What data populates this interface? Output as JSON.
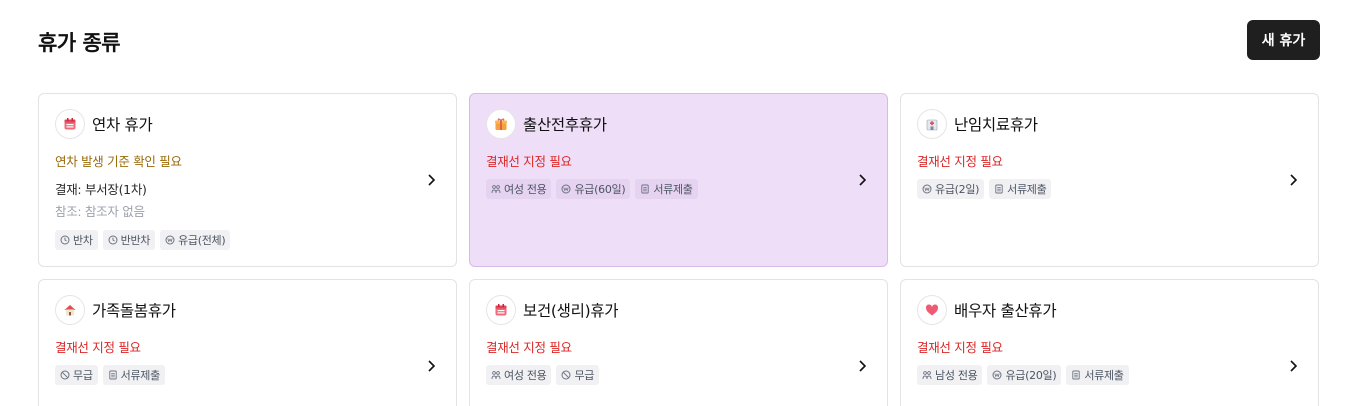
{
  "page": {
    "title": "휴가 종류",
    "new_button": "새 휴가"
  },
  "cards": [
    {
      "name": "연차 휴가",
      "icon": "calendar-icon",
      "warning": "연차 발생 기준 확인 필요",
      "approval": "결재: 부서장(1차)",
      "reference": "참조: 참조자 없음",
      "tags": [
        {
          "icon": "clock-icon",
          "label": "반차"
        },
        {
          "icon": "clock-icon",
          "label": "반반차"
        },
        {
          "icon": "pay-icon",
          "label": "유급(전체)"
        }
      ]
    },
    {
      "name": "출산전후휴가",
      "icon": "gift-icon",
      "warning": "결재선 지정 필요",
      "tags": [
        {
          "icon": "people-icon",
          "label": "여성 전용"
        },
        {
          "icon": "pay-icon",
          "label": "유급(60일)"
        },
        {
          "icon": "document-icon",
          "label": "서류제출"
        }
      ]
    },
    {
      "name": "난임치료휴가",
      "icon": "hospital-icon",
      "warning": "결재선 지정 필요",
      "tags": [
        {
          "icon": "pay-icon",
          "label": "유급(2일)"
        },
        {
          "icon": "document-icon",
          "label": "서류제출"
        }
      ]
    },
    {
      "name": "가족돌봄휴가",
      "icon": "house-icon",
      "warning": "결재선 지정 필요",
      "tags": [
        {
          "icon": "unpaid-icon",
          "label": "무급"
        },
        {
          "icon": "document-icon",
          "label": "서류제출"
        }
      ]
    },
    {
      "name": "보건(생리)휴가",
      "icon": "calendar-icon",
      "warning": "결재선 지정 필요",
      "tags": [
        {
          "icon": "people-icon",
          "label": "여성 전용"
        },
        {
          "icon": "unpaid-icon",
          "label": "무급"
        }
      ]
    },
    {
      "name": "배우자 출산휴가",
      "icon": "heart-icon",
      "warning": "결재선 지정 필요",
      "tags": [
        {
          "icon": "people-icon",
          "label": "남성 전용"
        },
        {
          "icon": "pay-icon",
          "label": "유급(20일)"
        },
        {
          "icon": "document-icon",
          "label": "서류제출"
        }
      ]
    }
  ],
  "colors": {
    "selected_card_bg": "#efdef8",
    "warning_red": "#dc2626",
    "warning_amber": "#9a6a0b",
    "primary_button": "#1f1f1f"
  }
}
